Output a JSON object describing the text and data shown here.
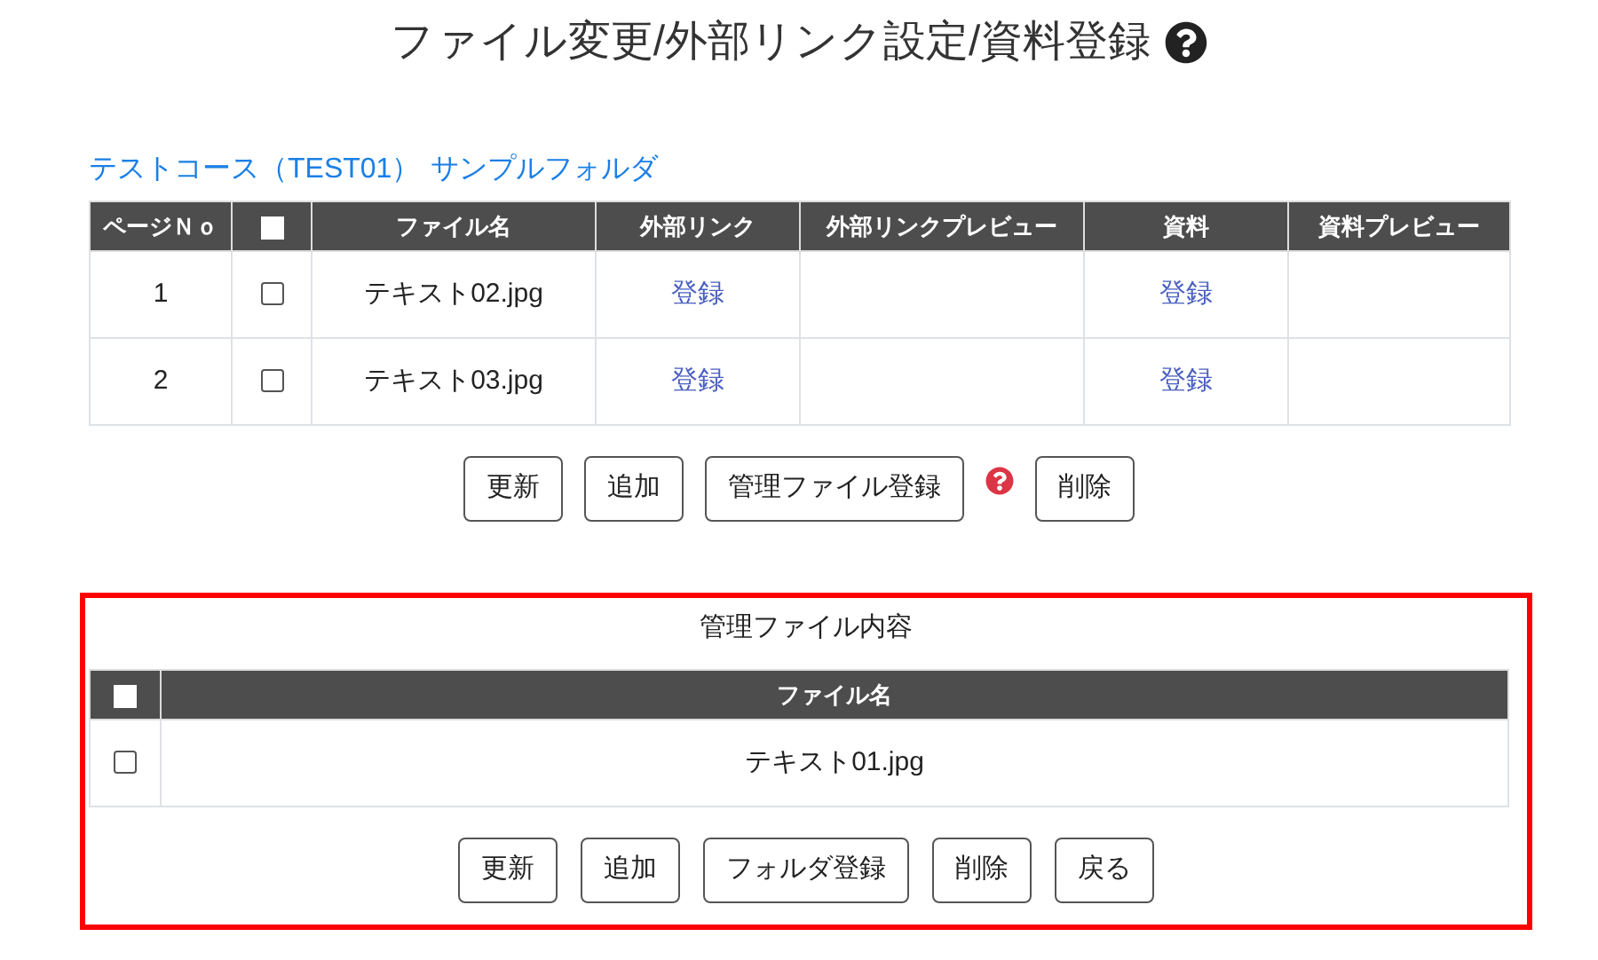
{
  "title": "ファイル変更/外部リンク設定/資料登録",
  "breadcrumb": {
    "course": "テストコース（TEST01）",
    "folder": "サンプルフォルダ"
  },
  "file_table": {
    "columns": [
      "ページＮｏ",
      "ファイル名",
      "外部リンク",
      "外部リンクプレビュー",
      "資料",
      "資料プレビュー"
    ],
    "select_all_checked": false,
    "rows": [
      {
        "page": "1",
        "checked": false,
        "file": "テキスト02.jpg",
        "link": "登録",
        "material": "登録"
      },
      {
        "page": "2",
        "checked": false,
        "file": "テキスト03.jpg",
        "link": "登録",
        "material": "登録"
      }
    ]
  },
  "file_actions": [
    {
      "label": "更新",
      "help": false
    },
    {
      "label": "追加",
      "help": false
    },
    {
      "label": "管理ファイル登録",
      "help": true
    },
    {
      "label": "削除",
      "help": false
    }
  ],
  "managed_panel": {
    "title": "管理ファイル内容",
    "columns": [
      "ファイル名"
    ],
    "select_all_checked": false,
    "rows": [
      {
        "checked": false,
        "file": "テキスト01.jpg"
      }
    ],
    "actions": [
      "更新",
      "追加",
      "フォルダ登録",
      "削除",
      "戻る"
    ]
  }
}
